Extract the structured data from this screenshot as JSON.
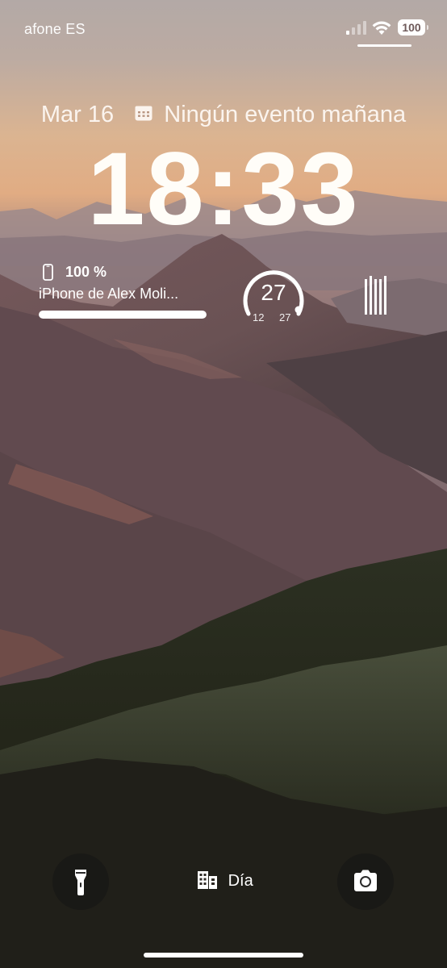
{
  "status_bar": {
    "carrier": "afone ES",
    "battery_level": "100",
    "signal_icon": "cellular-signal-icon",
    "wifi_icon": "wifi-icon"
  },
  "date_line": {
    "date": "Mar 16",
    "calendar_icon": "calendar-icon",
    "event": "Ningún evento mañana"
  },
  "clock": {
    "time": "18:33"
  },
  "battery_widget": {
    "percent_label": "100 %",
    "device_name": "iPhone de Alex Moli...",
    "level": 1.0,
    "icon": "iphone-icon"
  },
  "weather_widget": {
    "current": "27",
    "min": "12",
    "max": "27",
    "level": 1.0
  },
  "bars_widget": {
    "icon": "barcode-icon"
  },
  "bottom": {
    "flashlight_icon": "flashlight-icon",
    "camera_icon": "camera-icon",
    "focus_icon": "building-icon",
    "focus_label": "Día"
  },
  "colors": {
    "sky_top": "#b2a7a3",
    "sky_glow": "#e6b183",
    "mountain": "#6b5155",
    "forest": "#1f2418",
    "button_bg": "#141414"
  }
}
